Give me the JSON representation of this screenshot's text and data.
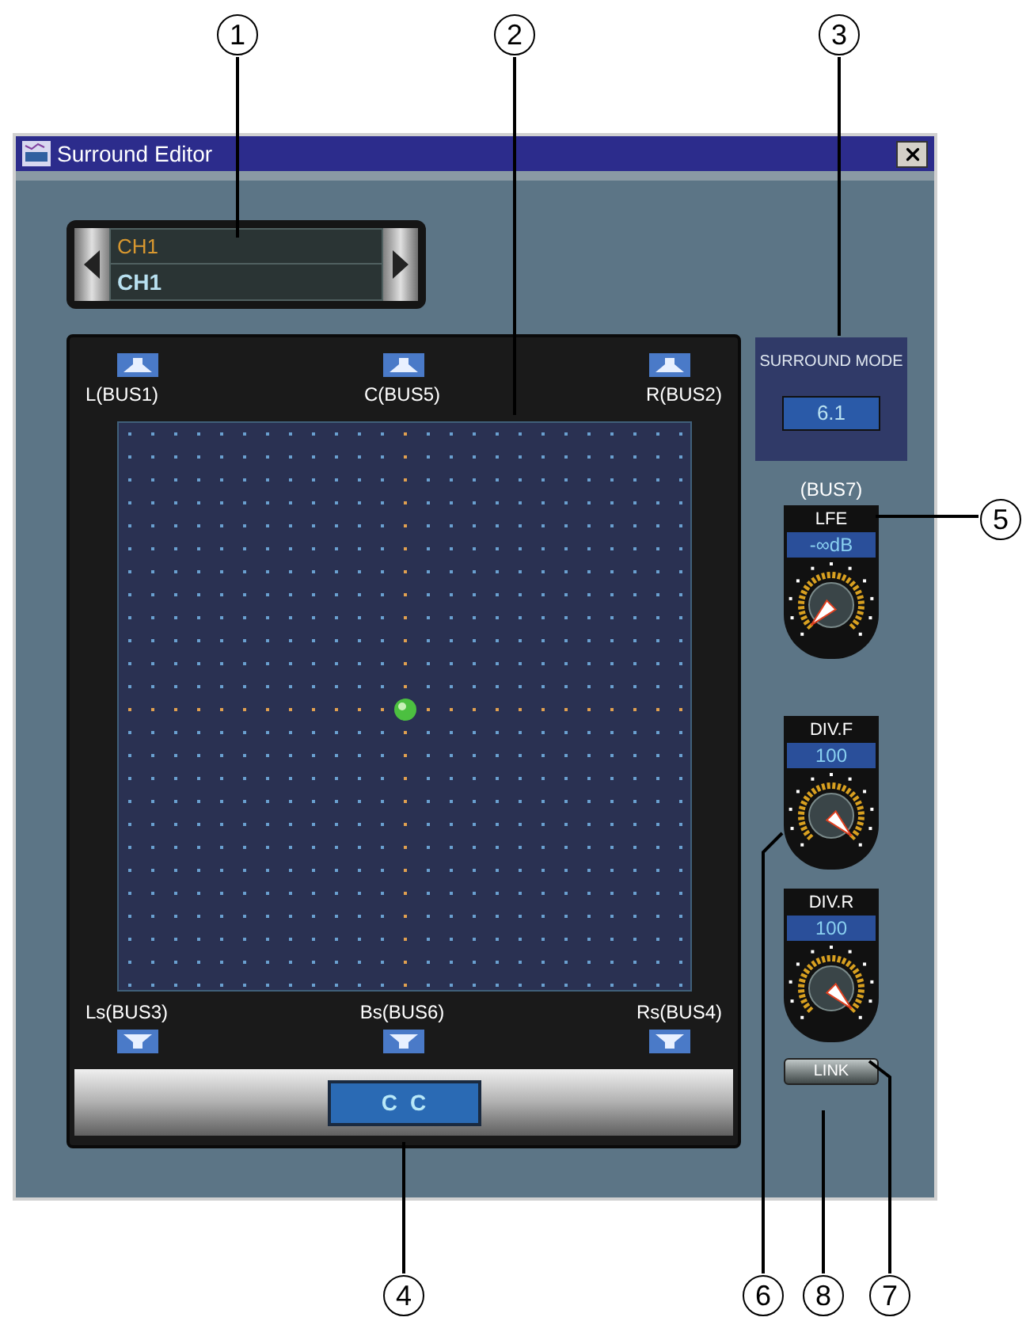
{
  "callouts": [
    {
      "label": "1"
    },
    {
      "label": "2"
    },
    {
      "label": "3"
    },
    {
      "label": "5"
    },
    {
      "label": "4"
    },
    {
      "label": "6"
    },
    {
      "label": "8"
    },
    {
      "label": "7"
    }
  ],
  "window": {
    "title": "Surround Editor"
  },
  "channel_selector": {
    "name": "CH1",
    "short_name": "CH1"
  },
  "speakers_top": [
    {
      "label": "L(BUS1)"
    },
    {
      "label": "C(BUS5)"
    },
    {
      "label": "R(BUS2)"
    }
  ],
  "speakers_bottom": [
    {
      "label": "Ls(BUS3)"
    },
    {
      "label": "Bs(BUS6)"
    },
    {
      "label": "Rs(BUS4)"
    }
  ],
  "position_display": [
    "C",
    "C"
  ],
  "surround_mode": {
    "title": "SURROUND MODE",
    "value": "6.1"
  },
  "lfe_bus": "(BUS7)",
  "knobs": [
    {
      "label": "LFE",
      "value": "-∞dB",
      "at_maximum": false
    },
    {
      "label": "DIV.F",
      "value": "100",
      "at_maximum": true
    },
    {
      "label": "DIV.R",
      "value": "100",
      "at_maximum": true
    }
  ],
  "link_button": {
    "label": "LINK"
  }
}
